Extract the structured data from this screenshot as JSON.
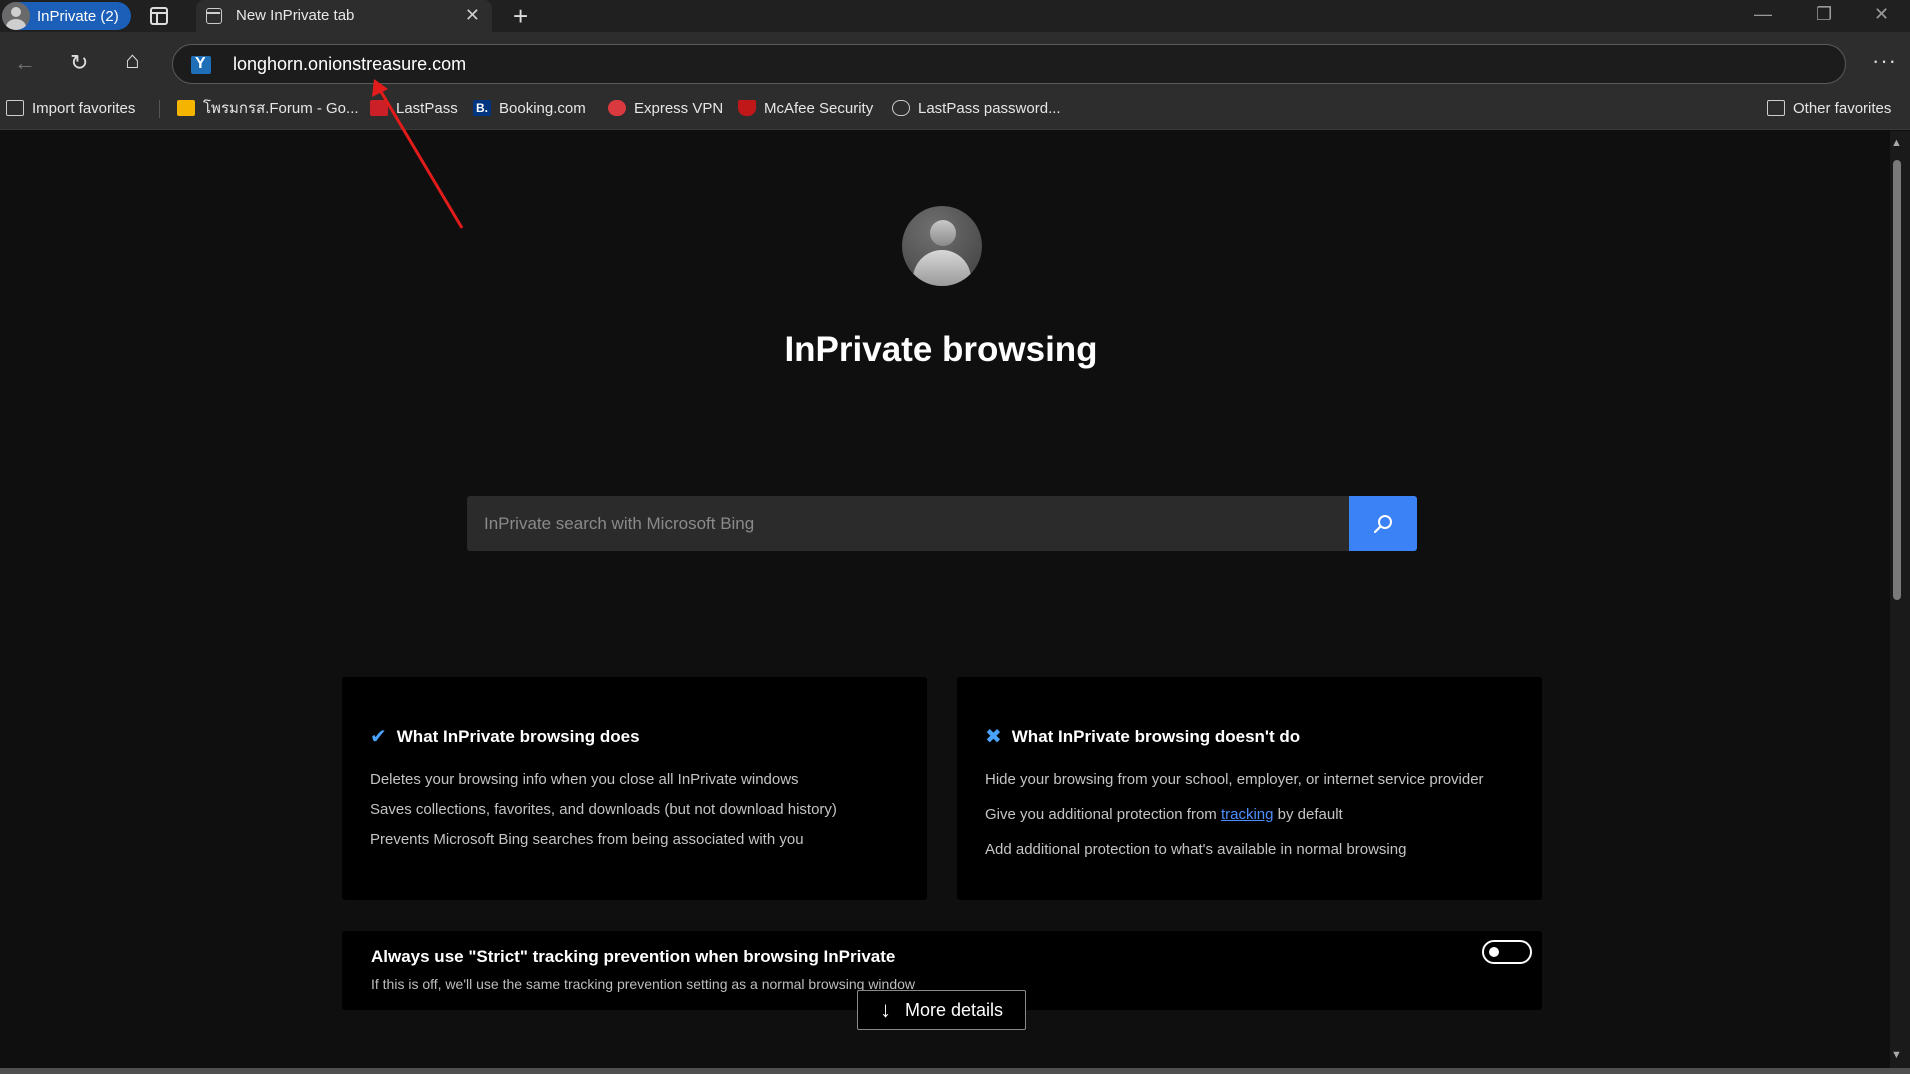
{
  "titlebar": {
    "inprivate_label": "InPrivate (2)",
    "tab_title": "New InPrivate tab",
    "tab_close": "✕",
    "new_tab": "+",
    "minimize": "—",
    "restore": "❐",
    "close": "✕"
  },
  "toolbar": {
    "back": "←",
    "refresh": "↻",
    "home": "⌂",
    "url": "longhorn.onionstreasure.com",
    "more": "···"
  },
  "favorites": {
    "items": [
      {
        "label": "Import favorites",
        "icon": "import-icon"
      },
      {
        "label": "โพรมกรส.Forum - Go...",
        "icon": "folder-yellow-icon"
      },
      {
        "label": "LastPass",
        "icon": "lastpass-icon"
      },
      {
        "label": "Booking.com",
        "icon": "booking-icon"
      },
      {
        "label": "Express VPN",
        "icon": "expressvpn-icon"
      },
      {
        "label": "McAfee Security",
        "icon": "mcafee-icon"
      },
      {
        "label": "LastPass password...",
        "icon": "globe-icon"
      }
    ],
    "other": "Other favorites"
  },
  "page": {
    "title": "InPrivate browsing",
    "search_placeholder": "InPrivate search with Microsoft Bing"
  },
  "does_card": {
    "title": "What InPrivate browsing does",
    "mark": "✔",
    "lines": [
      "Deletes your browsing info when you close all InPrivate windows",
      "Saves collections, favorites, and downloads (but not download history)",
      "Prevents Microsoft Bing searches from being associated with you"
    ]
  },
  "doesnt_card": {
    "title": "What InPrivate browsing doesn't do",
    "mark": "✖",
    "line1": "Hide your browsing from your school, employer, or internet service provider",
    "line2_prefix": "Give you additional protection from ",
    "line2_link": "tracking",
    "line2_suffix": " by default",
    "line3": "Add additional protection to what's available in normal browsing"
  },
  "strict": {
    "title": "Always use \"Strict\" tracking prevention when browsing InPrivate",
    "desc": "If this is off, we'll use the same tracking prevention setting as a normal browsing window",
    "toggle_on": false
  },
  "more_details": {
    "arrow": "↓",
    "label": "More details"
  },
  "colors": {
    "accent": "#3b82f6",
    "pill": "#1b5fb8",
    "annotation_arrow": "#e21b1b"
  }
}
